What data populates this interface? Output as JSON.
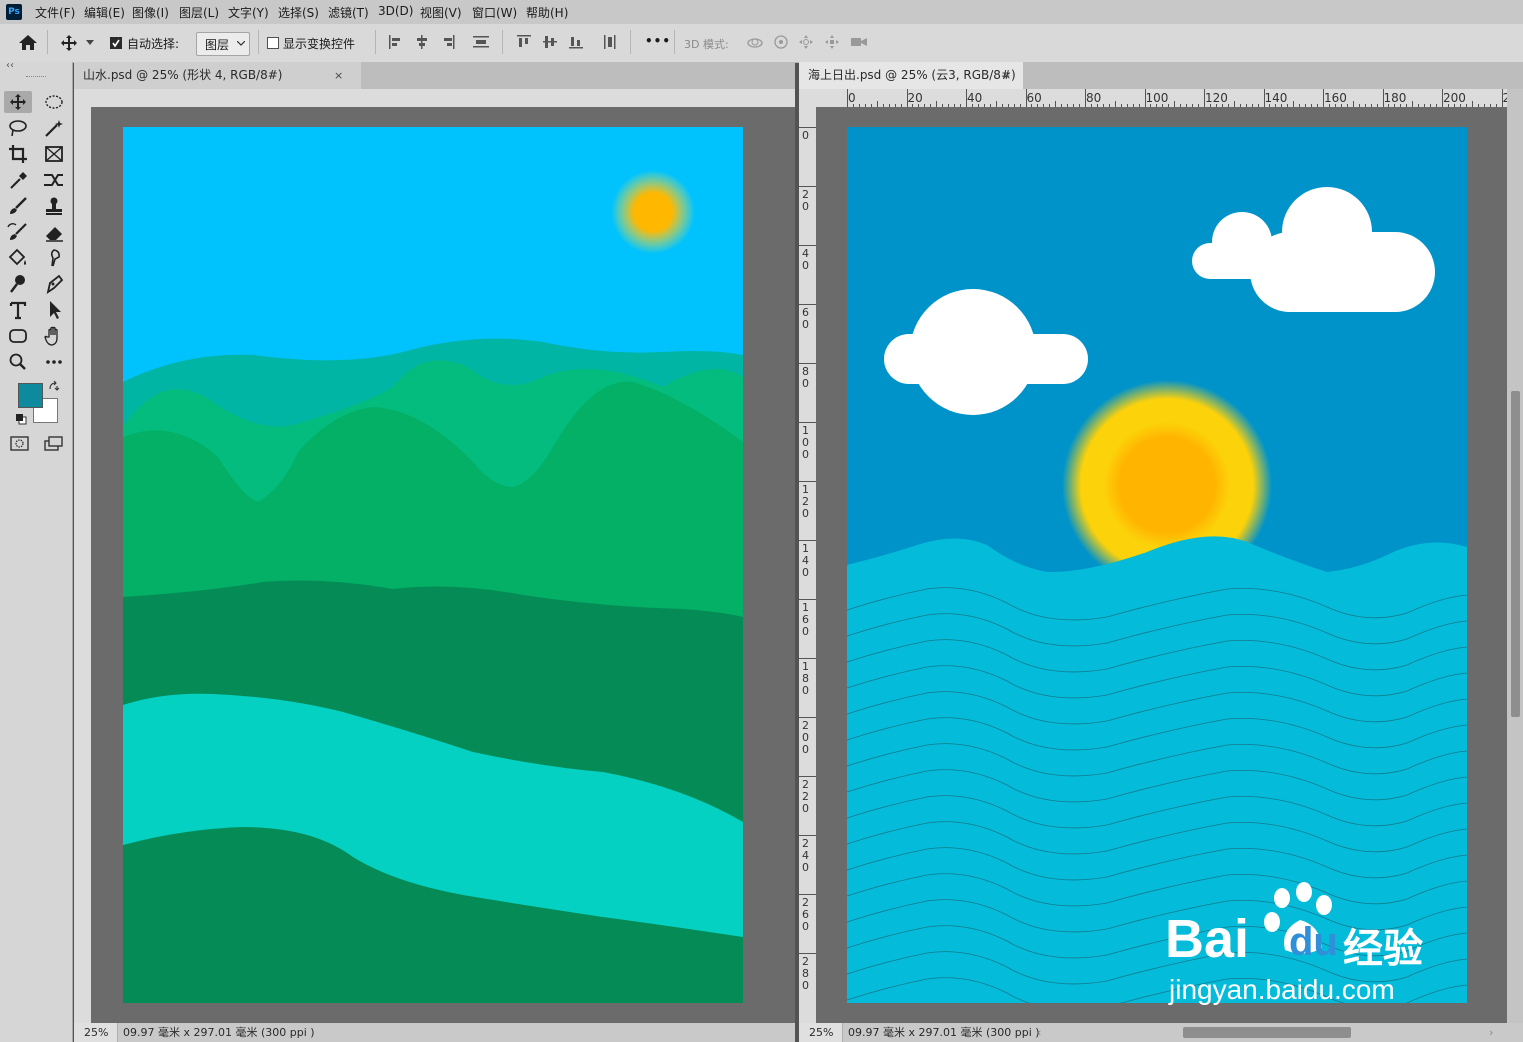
{
  "app": {
    "logo": "Ps"
  },
  "menu": [
    "文件(F)",
    "编辑(E)",
    "图像(I)",
    "图层(L)",
    "文字(Y)",
    "选择(S)",
    "滤镜(T)",
    "3D(D)",
    "视图(V)",
    "窗口(W)",
    "帮助(H)"
  ],
  "options_bar": {
    "auto_select_label": "自动选择:",
    "auto_select_checked": true,
    "auto_select_target": "图层",
    "show_transform_label": "显示变换控件",
    "show_transform_checked": false,
    "mode_3d_label": "3D 模式:",
    "more_label": "•••"
  },
  "colors": {
    "foreground": "#0e8a9e",
    "background": "#ffffff"
  },
  "documents": [
    {
      "tab_title": "山水.psd @ 25% (形状 4, RGB/8#)",
      "close": "×",
      "zoom": "25%",
      "doc_info": "09.97 毫米 x 297.01 毫米 (300 ppi )",
      "colors": {
        "sky": "#00c2fd",
        "sun": "#ffb700",
        "mountain_far": "#00b5a4",
        "mountain_mid": "#03bc7e",
        "mountain_near": "#03b066",
        "field_dark": "#058c56",
        "river": "#05d1c3"
      }
    },
    {
      "tab_title": "海上日出.psd @ 25% (云3, RGB/8#)",
      "close": "×",
      "zoom": "25%",
      "doc_info": "09.97 毫米 x 297.01 毫米 (300 ppi )",
      "ruler_h": [
        "0",
        "20",
        "40",
        "60",
        "80",
        "100",
        "120",
        "140",
        "160",
        "180",
        "200",
        "2"
      ],
      "ruler_v": [
        "0",
        "2\n0",
        "4\n0",
        "6\n0",
        "8\n0",
        "1\n0\n0",
        "1\n2\n0",
        "1\n4\n0",
        "1\n6\n0",
        "1\n8\n0",
        "2\n0\n0",
        "2\n2\n0",
        "2\n4\n0",
        "2\n6\n0",
        "2\n8\n0"
      ],
      "colors": {
        "sky": "#0093c9",
        "sun": "#fcd20a",
        "sun_core": "#ffb400",
        "cloud": "#ffffff",
        "sea": "#04bbd9",
        "wave_line": "#1a5f6e"
      }
    }
  ],
  "watermark": {
    "brand": "Bai",
    "brand2": "du",
    "suffix": "经验",
    "url": "jingyan.baidu.com"
  }
}
